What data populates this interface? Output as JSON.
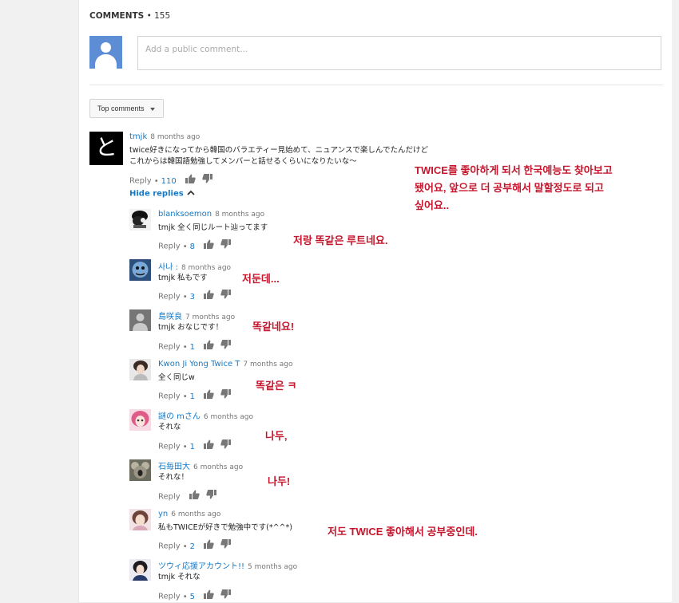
{
  "header": {
    "label": "COMMENTS",
    "separator": "•",
    "count": "155"
  },
  "new_comment": {
    "placeholder": "Add a public comment..."
  },
  "sort": {
    "label": "Top comments"
  },
  "main_comment": {
    "author": "tmjk",
    "timestamp": "8 months ago",
    "avatar_glyph": "と",
    "lines": [
      "twice好きになってから韓国のバラエティー見始めて、ニュアンスで楽しんでたんだけど",
      "これからは韓国語勉強してメンバーと話せるくらいになりたいな～"
    ],
    "reply_label": "Reply",
    "likes": "110",
    "hide_replies": "Hide replies"
  },
  "main_annotation": [
    "TWICE를 좋아하게 되서 한국예능도 찾아보고",
    "됐어요, 앞으로 더 공부해서 말할정도로 되고",
    "싶어요.."
  ],
  "replies": [
    {
      "author": "blanksoemon",
      "timestamp": "8 months ago",
      "text": "tmjk 全く同じルート辿ってます",
      "reply_label": "Reply",
      "likes": "8",
      "annotation": "저랑 똑같은 루트네요."
    },
    {
      "author": "사나 :",
      "timestamp": "8 months ago",
      "text": "tmjk 私もです",
      "reply_label": "Reply",
      "likes": "3",
      "annotation": "저둔데..."
    },
    {
      "author": "島咲良",
      "timestamp": "7 months ago",
      "text": "tmjk おなじです！",
      "reply_label": "Reply",
      "likes": "1",
      "annotation": "똑같네요!"
    },
    {
      "author": "Kwon Ji Yong Twice T",
      "timestamp": "7 months ago",
      "text": "全く同じw",
      "reply_label": "Reply",
      "likes": "1",
      "annotation": "똑같은 ㅋ"
    },
    {
      "author": "謎の mさん",
      "timestamp": "6 months ago",
      "text": "それな",
      "reply_label": "Reply",
      "likes": "1",
      "annotation": "나두,"
    },
    {
      "author": "石毎田大",
      "timestamp": "6 months ago",
      "text": "それな！",
      "reply_label": "Reply",
      "likes": "",
      "annotation": "나두!"
    },
    {
      "author": "yn",
      "timestamp": "6 months ago",
      "text": "私もTWICEが好きで勉強中です(*^^*)",
      "reply_label": "Reply",
      "likes": "2",
      "annotation": "저도 TWICE 좋아해서 공부중인데."
    },
    {
      "author": "ツウィ応援アカウント!!",
      "timestamp": "5 months ago",
      "text": "tmjk それな",
      "reply_label": "Reply",
      "likes": "5",
      "annotation": ""
    }
  ],
  "icons": {
    "like": "thumbs-up-icon",
    "dislike": "thumbs-down-icon",
    "chevron": "chevron-up-icon",
    "caret": "caret-down-icon"
  },
  "colors": {
    "link": "#167ac6",
    "annotation": "#c5162d",
    "avatar_default": "#5d8ed5"
  }
}
